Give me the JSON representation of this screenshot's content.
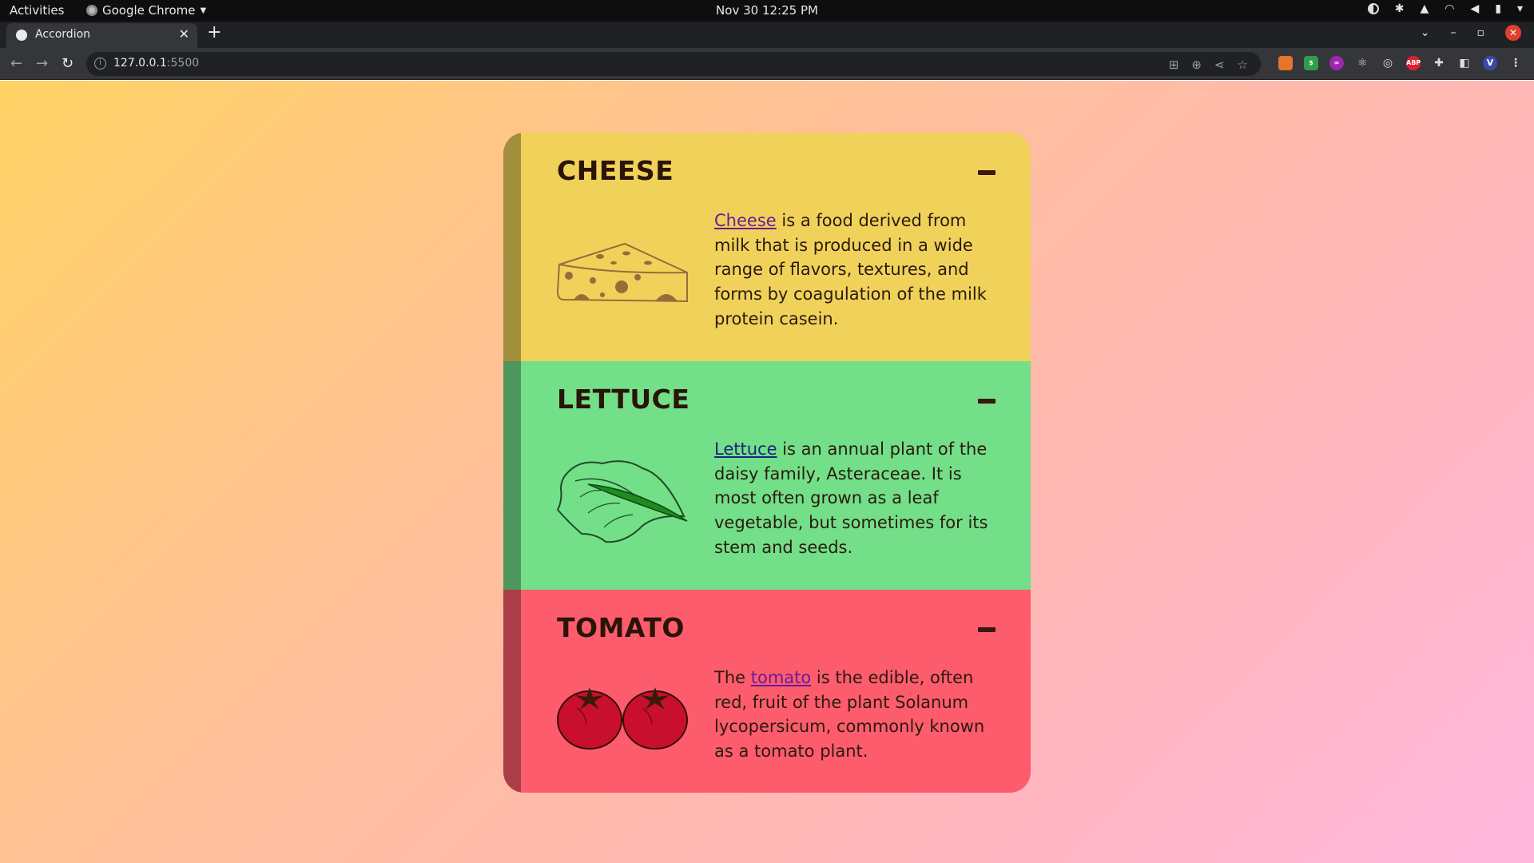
{
  "system": {
    "activities": "Activities",
    "app_name": "Google Chrome",
    "datetime": "Nov 30  12:25 PM"
  },
  "browser": {
    "tab_title": "Accordion",
    "url_host": "127.0.0.1",
    "url_port": ":5500"
  },
  "accordion": {
    "items": [
      {
        "title": "CHEESE",
        "link_text": "Cheese",
        "text_before": "",
        "text_after": " is a food derived from milk that is produced in a wide range of flavors, textures, and forms by coagulation of the milk protein casein.",
        "color": "#f0d25a",
        "icon": "cheese-icon"
      },
      {
        "title": "LETTUCE",
        "link_text": "Lettuce",
        "text_before": "",
        "text_after": " is an annual plant of the daisy family, Asteraceae. It is most often grown as a leaf vegetable, but sometimes for its stem and seeds.",
        "color": "#73df88",
        "icon": "lettuce-icon"
      },
      {
        "title": "TOMATO",
        "link_text": "tomato",
        "text_before": "The ",
        "text_after": " is the edible, often red, fruit of the plant Solanum lycopersicum, commonly known as a tomato plant.",
        "color": "#fc5c6c",
        "icon": "tomato-icon"
      }
    ]
  }
}
